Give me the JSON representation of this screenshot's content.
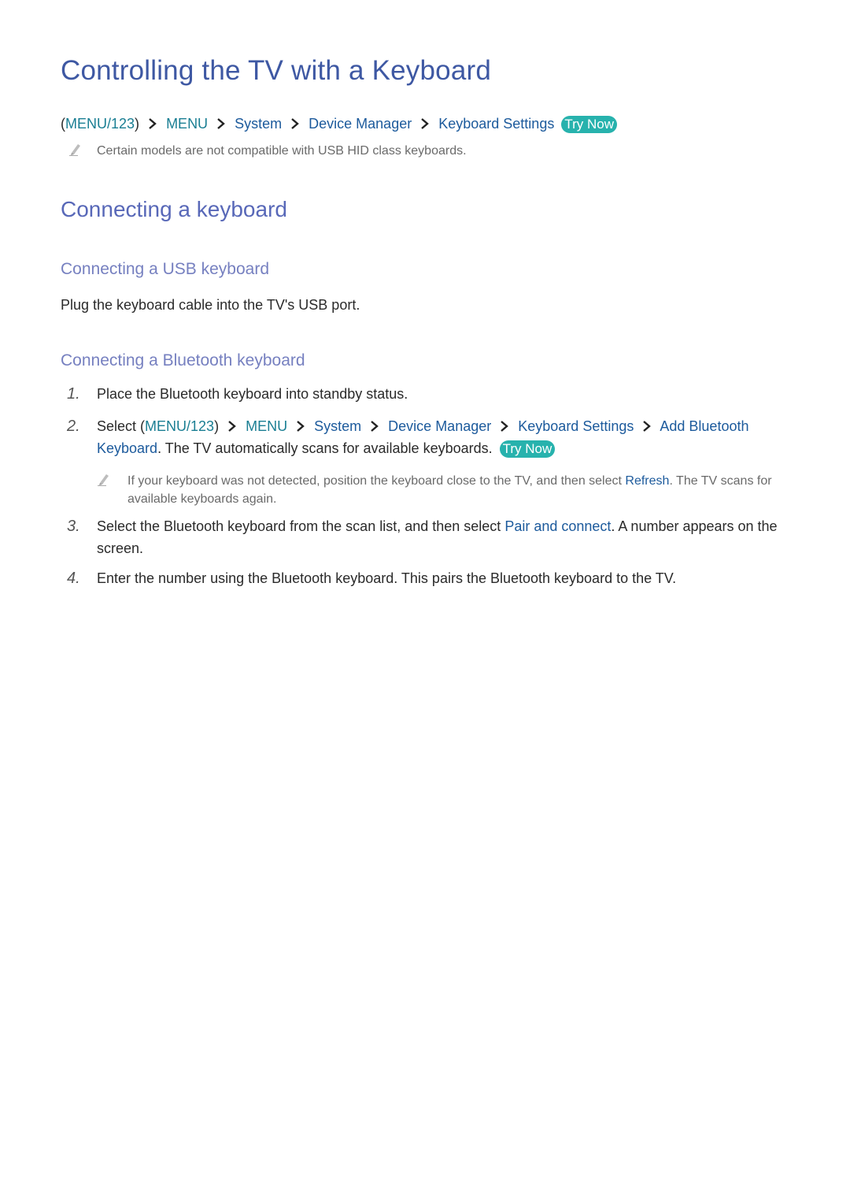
{
  "page": {
    "title": "Controlling the TV with a Keyboard",
    "path": {
      "items": [
        {
          "label": "(",
          "kind": "paren"
        },
        {
          "label": "MENU/123",
          "kind": "teal"
        },
        {
          "label": ")",
          "kind": "paren"
        },
        {
          "label": "MENU"
        },
        {
          "label": "System"
        },
        {
          "label": "Device Manager"
        },
        {
          "label": "Keyboard Settings"
        }
      ],
      "try_now": "Try Now"
    },
    "note1": "Certain models are not compatible with USB HID class keyboards."
  },
  "section": {
    "title": "Connecting a keyboard",
    "usb": {
      "title": "Connecting a USB keyboard",
      "text": "Plug the keyboard cable into the TV's USB port."
    },
    "bluetooth": {
      "title": "Connecting a Bluetooth keyboard",
      "steps": [
        {
          "num": "1.",
          "text": "Place the Bluetooth keyboard into standby status."
        },
        {
          "num": "2.",
          "select": "Select ",
          "open_paren": "(",
          "menu123": "MENU/123",
          "close_paren": ")",
          "menu": "MENU",
          "system": "System",
          "device_manager": "Device Manager",
          "keyboard_settings": "Keyboard Settings",
          "add_bt": "Add Bluetooth Keyboard",
          "rest": ". The TV automatically scans for available keyboards.",
          "try_now": "Try Now",
          "note_before": "If your keyboard was not detected, position the keyboard close to the TV, and then select ",
          "note_link": "Refresh",
          "note_after": ". The TV scans for available keyboards again."
        },
        {
          "num": "3.",
          "before": "Select the Bluetooth keyboard from the scan list, and then select ",
          "link": "Pair and connect",
          "after": ". A number appears on the screen."
        },
        {
          "num": "4.",
          "text": "Enter the number using the Bluetooth keyboard. This pairs the Bluetooth keyboard to the TV."
        }
      ]
    }
  },
  "colors": {
    "title": "#3e58a3",
    "h2": "#5868b8",
    "h3": "#7680c0",
    "link_teal": "#1a7e93",
    "link_blue": "#1c5a9c",
    "try_now_bg": "#27b2ad"
  }
}
